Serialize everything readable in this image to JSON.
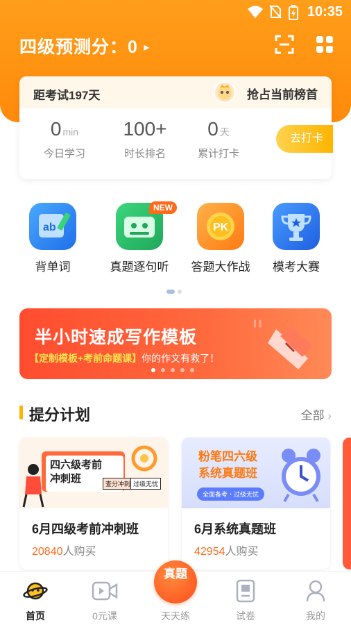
{
  "status_bar": {
    "time": "10:35"
  },
  "header": {
    "title": "四级预测分：0",
    "arrow": "▸"
  },
  "exam_card": {
    "countdown": "距考试197天",
    "rank_link": "抢占当前榜首",
    "stats": [
      {
        "value": "0",
        "unit": "min",
        "label": "今日学习"
      },
      {
        "value": "100+",
        "unit": "",
        "label": "时长排名"
      },
      {
        "value": "0",
        "unit": "天",
        "label": "累计打卡"
      }
    ],
    "checkin_label": "去打卡"
  },
  "quick_entries": [
    {
      "label": "背单词",
      "icon": "word-book-icon",
      "color": "#2f8dff"
    },
    {
      "label": "真题逐句听",
      "icon": "radio-icon",
      "color": "#2fc36a",
      "badge": "NEW"
    },
    {
      "label": "答题大作战",
      "icon": "pk-icon",
      "color": "#ff8a1a"
    },
    {
      "label": "模考大赛",
      "icon": "trophy-icon",
      "color": "#2f7dff"
    }
  ],
  "banner": {
    "title": "半小时速成写作模板",
    "sub_highlight": "【定制模板+考前命题课】",
    "sub_rest": "你的作文有救了！"
  },
  "section": {
    "title": "提分计划",
    "more": "全部"
  },
  "courses": [
    {
      "name": "6月四级考前冲刺班",
      "buyers": "20840",
      "buy_suffix": "人购买",
      "img_title_1": "四六级考前",
      "img_title_2": "冲刺班",
      "img_tag_1": "查分冲刺",
      "img_tag_2": "过级无忧"
    },
    {
      "name": "6月系统真题班",
      "buyers": "42954",
      "buy_suffix": "人购买",
      "img_title_1": "粉笔四六级",
      "img_title_2": "系统真题班",
      "img_tag_1": "全面备考・过级无忧"
    }
  ],
  "bottom_nav": [
    {
      "label": "首页",
      "icon": "home-planet-icon",
      "active": true
    },
    {
      "label": "0元课",
      "icon": "video-icon",
      "active": false
    },
    {
      "label": "天天练",
      "icon": "daily-practice-icon",
      "active": false,
      "center_text": "真题"
    },
    {
      "label": "试卷",
      "icon": "paper-icon",
      "active": false
    },
    {
      "label": "我的",
      "icon": "profile-icon",
      "active": false
    }
  ]
}
